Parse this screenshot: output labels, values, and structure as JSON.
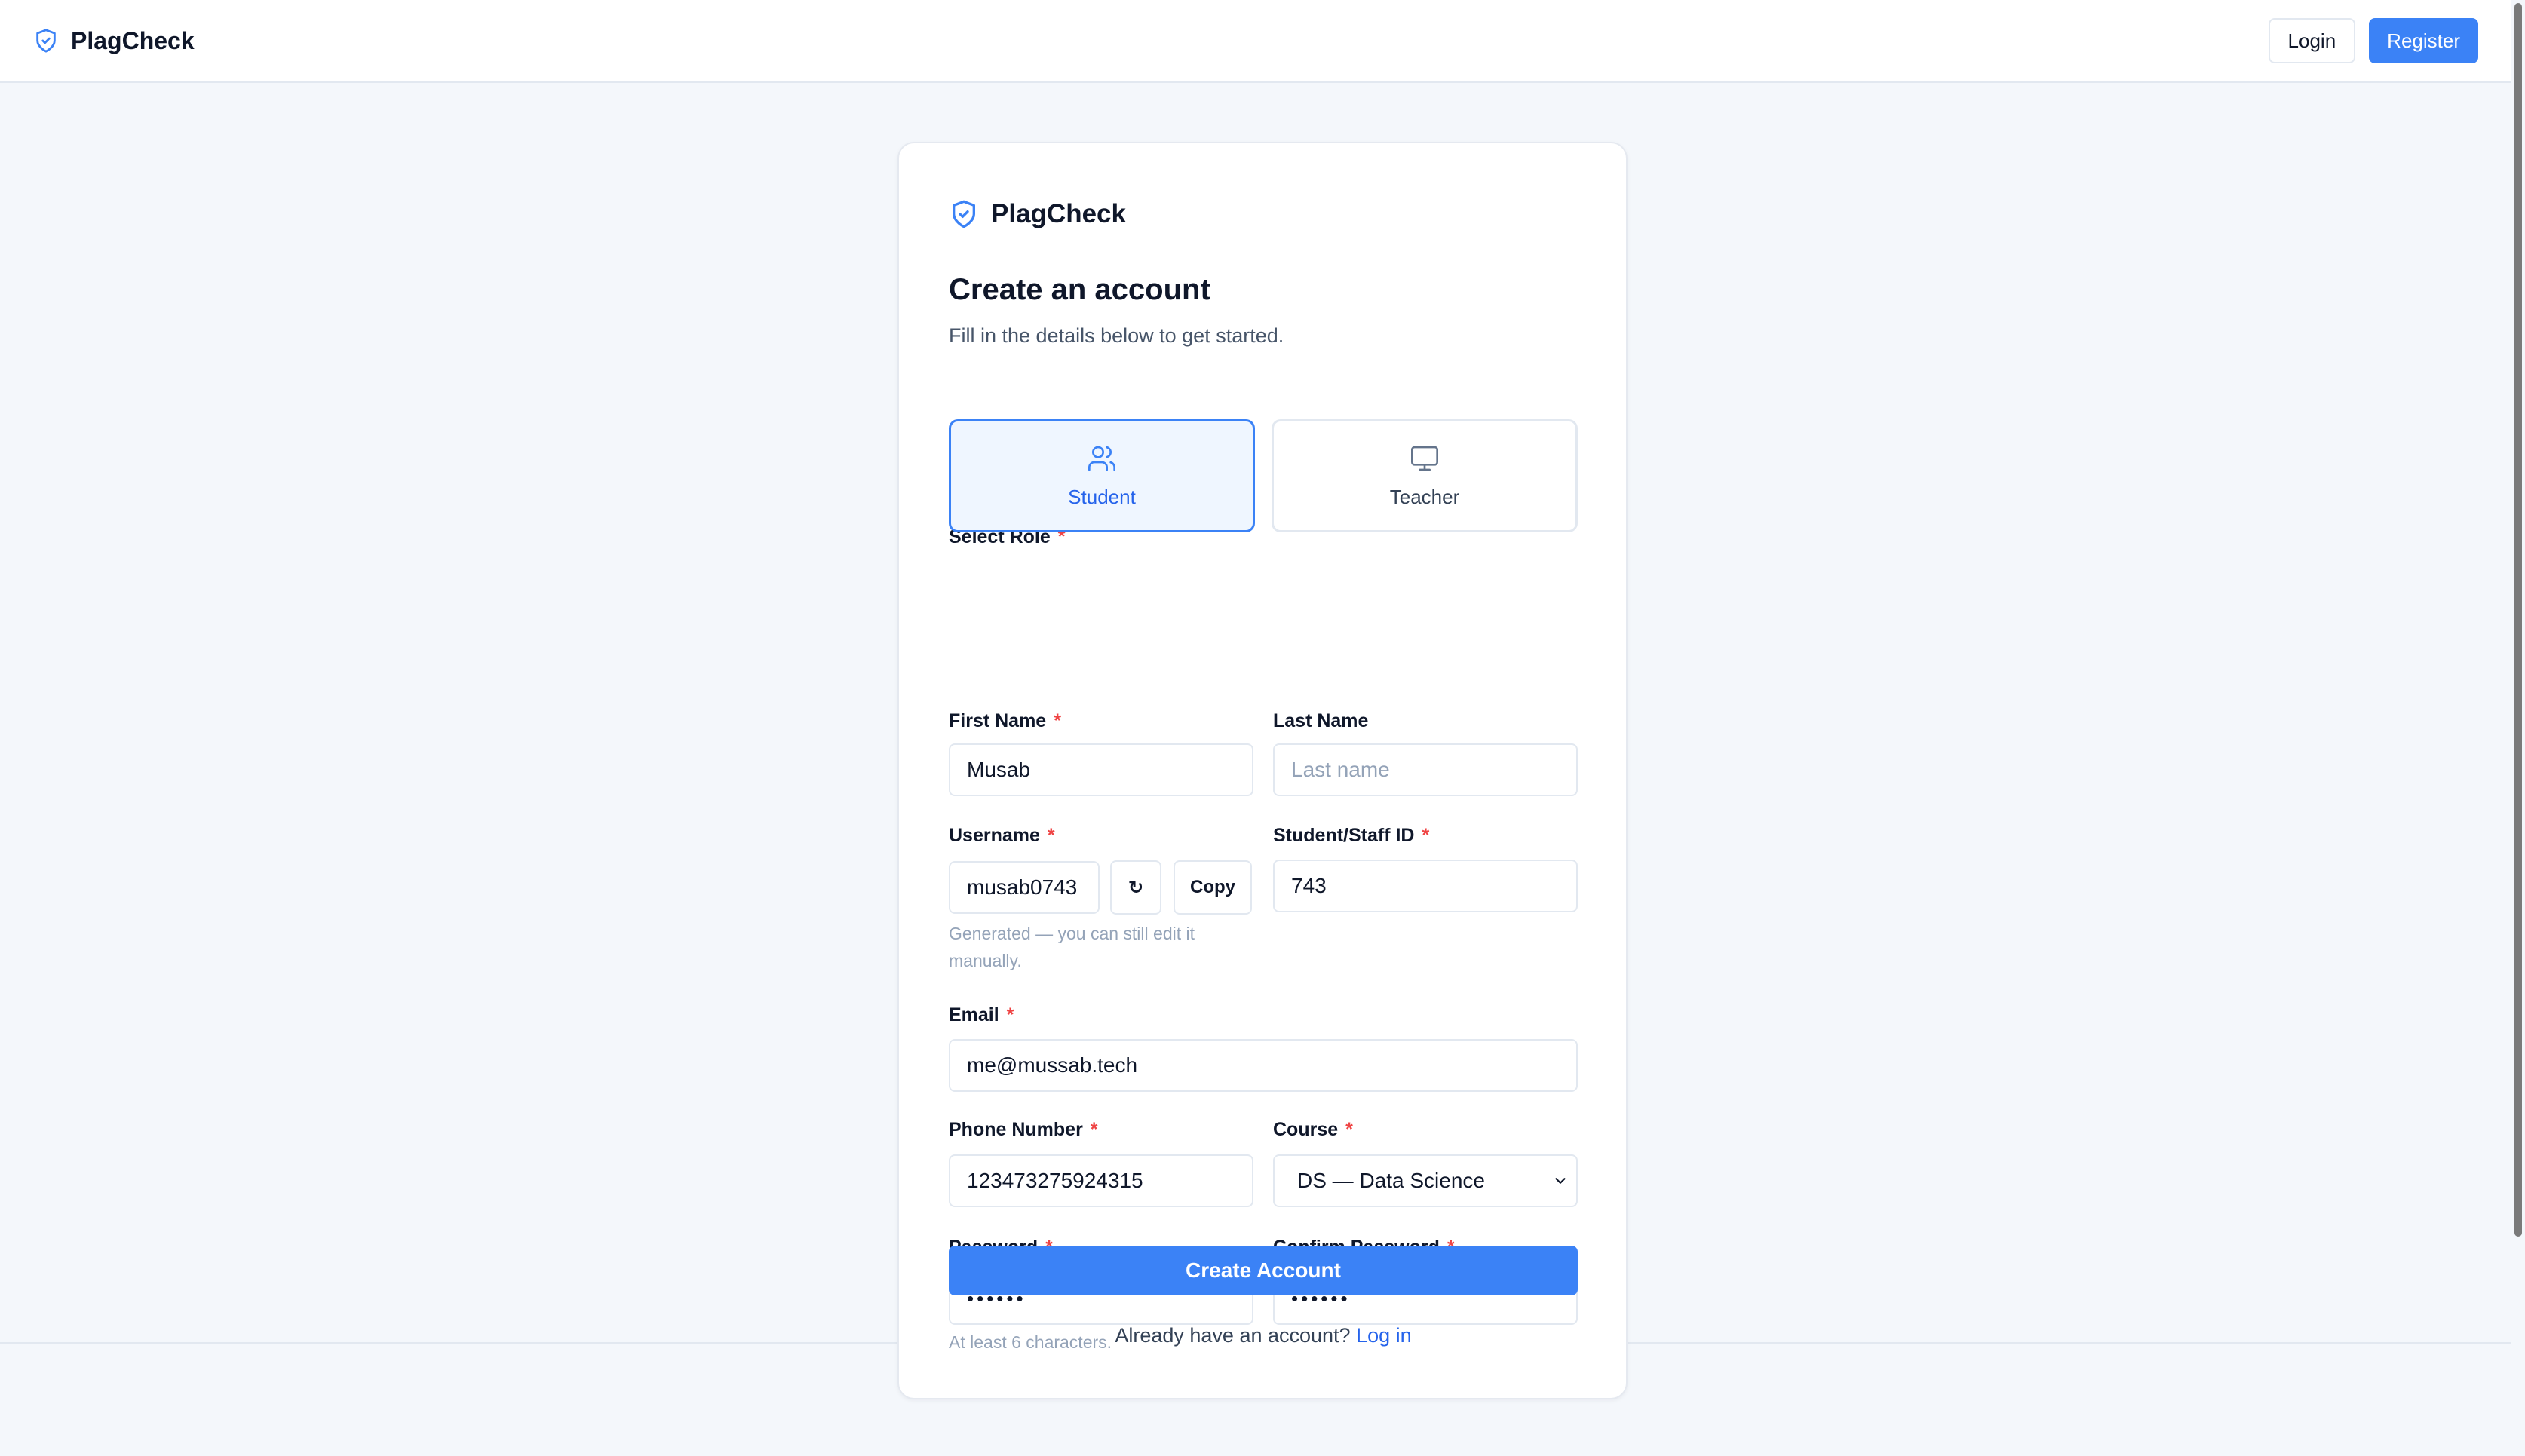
{
  "header": {
    "brand": "PlagCheck",
    "login_label": "Login",
    "register_label": "Register"
  },
  "card": {
    "brand": "PlagCheck",
    "title": "Create an account",
    "subtitle": "Fill in the details below to get started."
  },
  "form": {
    "required_mark": "*",
    "role": {
      "label": "Select Role",
      "options": [
        {
          "label": "Student",
          "icon": "users-icon",
          "selected": true
        },
        {
          "label": "Teacher",
          "icon": "monitor-icon",
          "selected": false
        }
      ]
    },
    "first_name": {
      "label": "First Name",
      "value": "Musab"
    },
    "last_name": {
      "label": "Last Name",
      "value": "",
      "placeholder": "Last name"
    },
    "username": {
      "label": "Username",
      "value": "musab0743",
      "regenerate_icon": "↻",
      "copy_label": "Copy",
      "hint": "Generated — you can still edit it manually."
    },
    "student_id": {
      "label": "Student/Staff ID",
      "value": "743"
    },
    "email": {
      "label": "Email",
      "value": "me@mussab.tech"
    },
    "phone": {
      "label": "Phone Number",
      "value": "123473275924315"
    },
    "course": {
      "label": "Course",
      "value": "DS — Data Science"
    },
    "password": {
      "label": "Password",
      "value": "••••••",
      "hint": "At least 6 characters."
    },
    "confirm_password": {
      "label": "Confirm Password",
      "value": "••••••"
    },
    "submit_label": "Create Account",
    "login_prompt": "Already have an account?",
    "login_link": "Log in"
  },
  "colors": {
    "accent": "#3b82f6",
    "required": "#ef4444",
    "background": "#f4f7fb"
  }
}
